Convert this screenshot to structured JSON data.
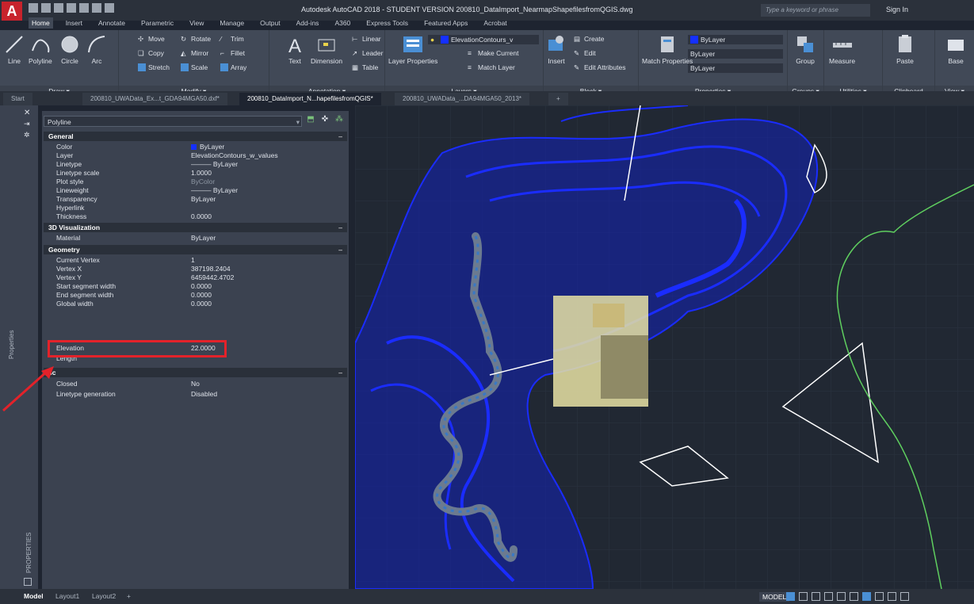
{
  "window": {
    "title": "Autodesk AutoCAD 2018 - STUDENT VERSION   200810_DataImport_NearmapShapefilesfromQGIS.dwg",
    "search_placeholder": "Type a keyword or phrase",
    "signin": "Sign In"
  },
  "ribbon_tabs": [
    "Home",
    "Insert",
    "Annotate",
    "Parametric",
    "View",
    "Manage",
    "Output",
    "Add-ins",
    "A360",
    "Express Tools",
    "Featured Apps",
    "Acrobat"
  ],
  "ribbon": {
    "draw": {
      "label": "Draw ▾",
      "line": "Line",
      "polyline": "Polyline",
      "circle": "Circle",
      "arc": "Arc"
    },
    "modify": {
      "label": "Modify ▾",
      "move": "Move",
      "rotate": "Rotate",
      "trim": "Trim",
      "copy": "Copy",
      "mirror": "Mirror",
      "fillet": "Fillet",
      "stretch": "Stretch",
      "scale": "Scale",
      "array": "Array"
    },
    "annotation": {
      "label": "Annotation ▾",
      "text": "Text",
      "dimension": "Dimension",
      "linear": "Linear",
      "leader": "Leader",
      "table": "Table"
    },
    "layers": {
      "label": "Layers ▾",
      "layer_properties": "Layer Properties",
      "layer_combo": "ElevationContours_v",
      "make_current": "Make Current",
      "match_layer": "Match Layer"
    },
    "block": {
      "label": "Block ▾",
      "insert": "Insert",
      "create": "Create",
      "edit": "Edit",
      "edit_attributes": "Edit Attributes"
    },
    "properties": {
      "label": "Properties ▾",
      "match_properties": "Match Properties",
      "color": "ByLayer",
      "linetype": "ByLayer",
      "lineweight": "ByLayer"
    },
    "groups": {
      "label": "Groups ▾",
      "group": "Group"
    },
    "utilities": {
      "label": "Utilities ▾",
      "measure": "Measure"
    },
    "clipboard": {
      "label": "Clipboard",
      "paste": "Paste"
    },
    "view": {
      "label": "View ▾",
      "base": "Base"
    }
  },
  "doc_tabs": [
    "Start",
    "200810_UWAData_Ex...t_GDA94MGA50.dxf*",
    "200810_DataImport_N...hapefilesfromQGIS*",
    "200810_UWAData_...DA94MGA50_2013*"
  ],
  "palette": {
    "side_label": "PROPERTIES",
    "tab_label": "Properties",
    "object_type": "Polyline",
    "sections": {
      "general": "General",
      "viz3d": "3D Visualization",
      "geometry": "Geometry",
      "misc": "sc"
    },
    "general": [
      {
        "k": "Color",
        "v": "ByLayer"
      },
      {
        "k": "Layer",
        "v": "ElevationContours_w_values"
      },
      {
        "k": "Linetype",
        "v": "——— ByLayer"
      },
      {
        "k": "Linetype scale",
        "v": "1.0000"
      },
      {
        "k": "Plot style",
        "v": "ByColor"
      },
      {
        "k": "Lineweight",
        "v": "——— ByLayer"
      },
      {
        "k": "Transparency",
        "v": "ByLayer"
      },
      {
        "k": "Hyperlink",
        "v": ""
      },
      {
        "k": "Thickness",
        "v": "0.0000"
      }
    ],
    "viz3d": [
      {
        "k": "Material",
        "v": "ByLayer"
      }
    ],
    "geometry": [
      {
        "k": "Current Vertex",
        "v": "1"
      },
      {
        "k": "Vertex X",
        "v": "387198.2404"
      },
      {
        "k": "Vertex Y",
        "v": "6459442.4702"
      },
      {
        "k": "Start segment width",
        "v": "0.0000"
      },
      {
        "k": "End segment width",
        "v": "0.0000"
      },
      {
        "k": "Global width",
        "v": "0.0000"
      },
      {
        "k": "Elevation",
        "v": "22.0000"
      },
      {
        "k": "Length",
        "v": ""
      }
    ],
    "misc": [
      {
        "k": "Closed",
        "v": "No"
      },
      {
        "k": "Linetype generation",
        "v": "Disabled"
      }
    ]
  },
  "status": {
    "layouts": [
      "Model",
      "Layout1",
      "Layout2",
      "+"
    ],
    "model_button": "MODEL"
  },
  "colors": {
    "accent": "#1530ff",
    "highlight": "#e3222a",
    "canvas": "#212833"
  }
}
